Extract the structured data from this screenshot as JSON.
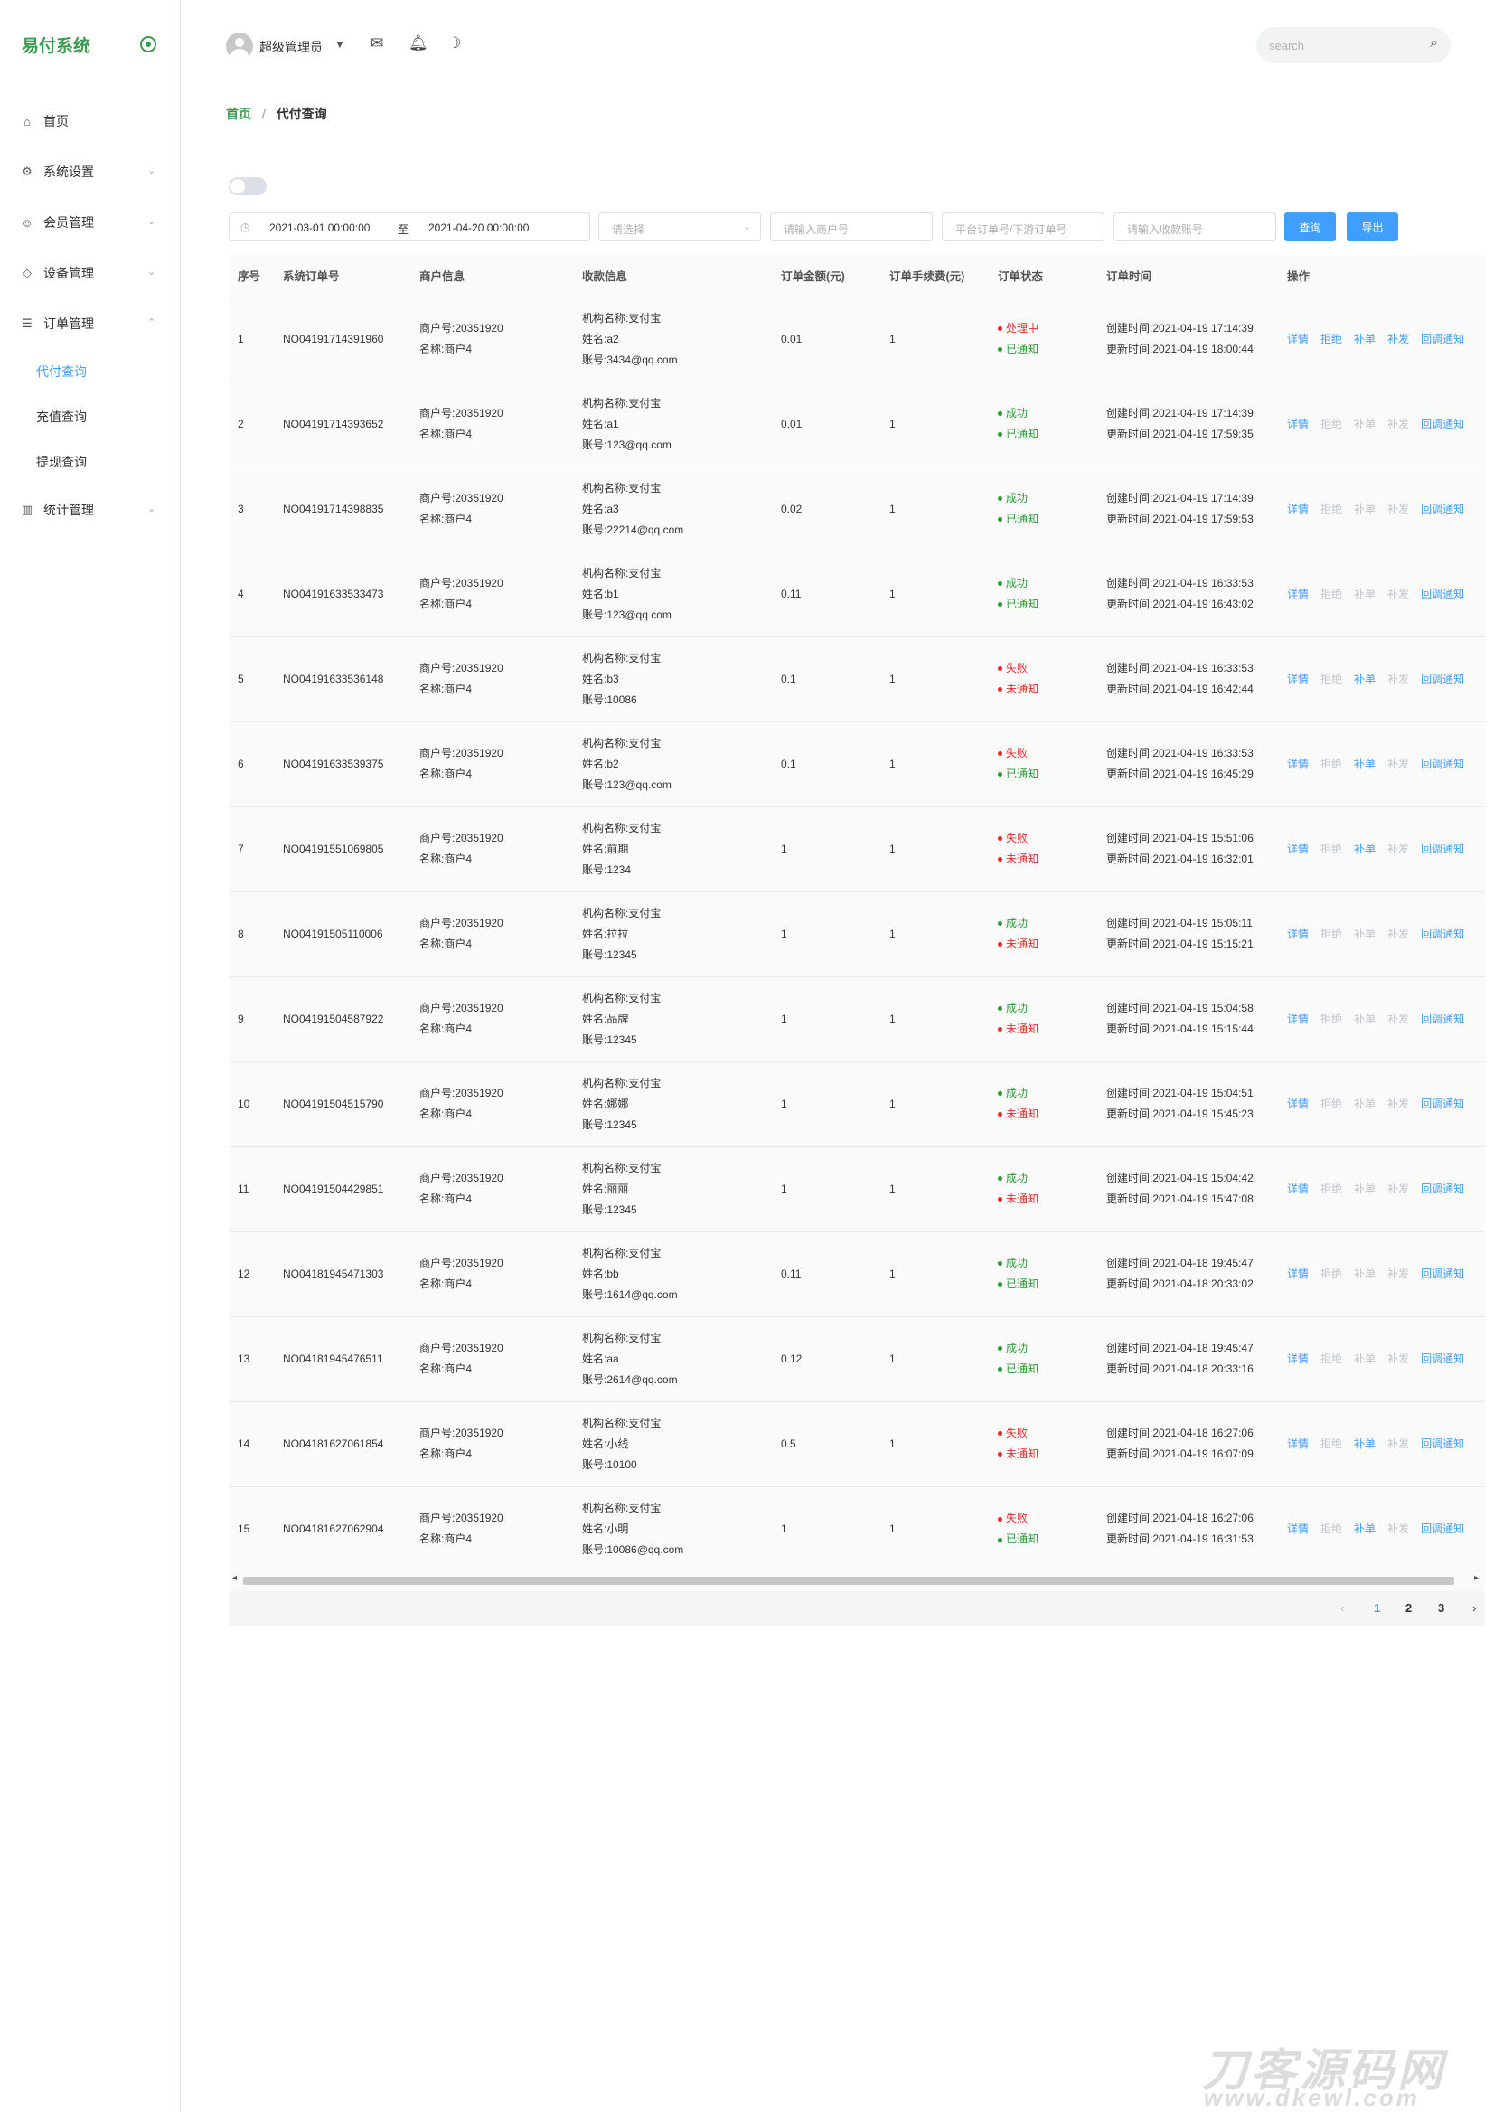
{
  "brand": {
    "name": "易付系统"
  },
  "sidebar": {
    "items": [
      {
        "label": "首页",
        "icon": "home-icon",
        "has_chevron": false
      },
      {
        "label": "系统设置",
        "icon": "gear-icon",
        "has_chevron": true
      },
      {
        "label": "会员管理",
        "icon": "users-icon",
        "has_chevron": true
      },
      {
        "label": "设备管理",
        "icon": "shield-icon",
        "has_chevron": true
      },
      {
        "label": "订单管理",
        "icon": "list-icon",
        "has_chevron": true,
        "expanded": true
      }
    ],
    "submenu": [
      {
        "label": "代付查询",
        "active": true
      },
      {
        "label": "充值查询",
        "active": false
      },
      {
        "label": "提现查询",
        "active": false
      }
    ],
    "last_item": {
      "label": "统计管理",
      "icon": "chart-icon"
    }
  },
  "header": {
    "user_name": "超级管理员",
    "search_placeholder": "search"
  },
  "breadcrumb": {
    "home": "首页",
    "separator": "/",
    "current": "代付查询"
  },
  "filters": {
    "date_start": "2021-03-01 00:00:00",
    "date_sep": "至",
    "date_end": "2021-04-20 00:00:00",
    "select_placeholder": "请选择",
    "merchant_placeholder": "请输入商户号",
    "order_placeholder": "平台订单号/下游订单号",
    "account_placeholder": "请输入收款账号",
    "query_label": "查询",
    "export_label": "导出"
  },
  "table": {
    "headers": [
      "序号",
      "系统订单号",
      "商户信息",
      "收款信息",
      "订单金额(元)",
      "订单手续费(元)",
      "订单状态",
      "订单时间",
      "操作"
    ],
    "op_labels": [
      "详情",
      "拒绝",
      "补单",
      "补发",
      "回调通知"
    ],
    "rows": [
      {
        "no": "1",
        "order": "NO04191714391960",
        "merchant": [
          "商户号:20351920",
          "名称:商户4"
        ],
        "payee": [
          "机构名称:支付宝",
          "姓名:a2",
          "账号:3434@qq.com"
        ],
        "amount": "0.01",
        "fee": "1",
        "status": [
          "处理中",
          "已通知"
        ],
        "status_ok": [
          false,
          true
        ],
        "times": [
          "创建时间:2021-04-19 17:14:39",
          "更新时间:2021-04-19 18:00:44"
        ],
        "ops_on": [
          true,
          true,
          true,
          true,
          true
        ]
      },
      {
        "no": "2",
        "order": "NO04191714393652",
        "merchant": [
          "商户号:20351920",
          "名称:商户4"
        ],
        "payee": [
          "机构名称:支付宝",
          "姓名:a1",
          "账号:123@qq.com"
        ],
        "amount": "0.01",
        "fee": "1",
        "status": [
          "成功",
          "已通知"
        ],
        "status_ok": [
          true,
          true
        ],
        "times": [
          "创建时间:2021-04-19 17:14:39",
          "更新时间:2021-04-19 17:59:35"
        ],
        "ops_on": [
          true,
          false,
          false,
          false,
          true
        ]
      },
      {
        "no": "3",
        "order": "NO04191714398835",
        "merchant": [
          "商户号:20351920",
          "名称:商户4"
        ],
        "payee": [
          "机构名称:支付宝",
          "姓名:a3",
          "账号:22214@qq.com"
        ],
        "amount": "0.02",
        "fee": "1",
        "status": [
          "成功",
          "已通知"
        ],
        "status_ok": [
          true,
          true
        ],
        "times": [
          "创建时间:2021-04-19 17:14:39",
          "更新时间:2021-04-19 17:59:53"
        ],
        "ops_on": [
          true,
          false,
          false,
          false,
          true
        ]
      },
      {
        "no": "4",
        "order": "NO04191633533473",
        "merchant": [
          "商户号:20351920",
          "名称:商户4"
        ],
        "payee": [
          "机构名称:支付宝",
          "姓名:b1",
          "账号:123@qq.com"
        ],
        "amount": "0.11",
        "fee": "1",
        "status": [
          "成功",
          "已通知"
        ],
        "status_ok": [
          true,
          true
        ],
        "times": [
          "创建时间:2021-04-19 16:33:53",
          "更新时间:2021-04-19 16:43:02"
        ],
        "ops_on": [
          true,
          false,
          false,
          false,
          true
        ]
      },
      {
        "no": "5",
        "order": "NO04191633536148",
        "merchant": [
          "商户号:20351920",
          "名称:商户4"
        ],
        "payee": [
          "机构名称:支付宝",
          "姓名:b3",
          "账号:10086"
        ],
        "amount": "0.1",
        "fee": "1",
        "status": [
          "失败",
          "未通知"
        ],
        "status_ok": [
          false,
          false
        ],
        "times": [
          "创建时间:2021-04-19 16:33:53",
          "更新时间:2021-04-19 16:42:44"
        ],
        "ops_on": [
          true,
          false,
          true,
          false,
          true
        ]
      },
      {
        "no": "6",
        "order": "NO04191633539375",
        "merchant": [
          "商户号:20351920",
          "名称:商户4"
        ],
        "payee": [
          "机构名称:支付宝",
          "姓名:b2",
          "账号:123@qq.com"
        ],
        "amount": "0.1",
        "fee": "1",
        "status": [
          "失败",
          "已通知"
        ],
        "status_ok": [
          false,
          true
        ],
        "times": [
          "创建时间:2021-04-19 16:33:53",
          "更新时间:2021-04-19 16:45:29"
        ],
        "ops_on": [
          true,
          false,
          true,
          false,
          true
        ]
      },
      {
        "no": "7",
        "order": "NO04191551069805",
        "merchant": [
          "商户号:20351920",
          "名称:商户4"
        ],
        "payee": [
          "机构名称:支付宝",
          "姓名:前期",
          "账号:1234"
        ],
        "amount": "1",
        "fee": "1",
        "status": [
          "失败",
          "未通知"
        ],
        "status_ok": [
          false,
          false
        ],
        "times": [
          "创建时间:2021-04-19 15:51:06",
          "更新时间:2021-04-19 16:32:01"
        ],
        "ops_on": [
          true,
          false,
          true,
          false,
          true
        ]
      },
      {
        "no": "8",
        "order": "NO04191505110006",
        "merchant": [
          "商户号:20351920",
          "名称:商户4"
        ],
        "payee": [
          "机构名称:支付宝",
          "姓名:拉拉",
          "账号:12345"
        ],
        "amount": "1",
        "fee": "1",
        "status": [
          "成功",
          "未通知"
        ],
        "status_ok": [
          true,
          false
        ],
        "times": [
          "创建时间:2021-04-19 15:05:11",
          "更新时间:2021-04-19 15:15:21"
        ],
        "ops_on": [
          true,
          false,
          false,
          false,
          true
        ]
      },
      {
        "no": "9",
        "order": "NO04191504587922",
        "merchant": [
          "商户号:20351920",
          "名称:商户4"
        ],
        "payee": [
          "机构名称:支付宝",
          "姓名:品牌",
          "账号:12345"
        ],
        "amount": "1",
        "fee": "1",
        "status": [
          "成功",
          "未通知"
        ],
        "status_ok": [
          true,
          false
        ],
        "times": [
          "创建时间:2021-04-19 15:04:58",
          "更新时间:2021-04-19 15:15:44"
        ],
        "ops_on": [
          true,
          false,
          false,
          false,
          true
        ]
      },
      {
        "no": "10",
        "order": "NO04191504515790",
        "merchant": [
          "商户号:20351920",
          "名称:商户4"
        ],
        "payee": [
          "机构名称:支付宝",
          "姓名:娜娜",
          "账号:12345"
        ],
        "amount": "1",
        "fee": "1",
        "status": [
          "成功",
          "未通知"
        ],
        "status_ok": [
          true,
          false
        ],
        "times": [
          "创建时间:2021-04-19 15:04:51",
          "更新时间:2021-04-19 15:45:23"
        ],
        "ops_on": [
          true,
          false,
          false,
          false,
          true
        ]
      },
      {
        "no": "11",
        "order": "NO04191504429851",
        "merchant": [
          "商户号:20351920",
          "名称:商户4"
        ],
        "payee": [
          "机构名称:支付宝",
          "姓名:丽丽",
          "账号:12345"
        ],
        "amount": "1",
        "fee": "1",
        "status": [
          "成功",
          "未通知"
        ],
        "status_ok": [
          true,
          false
        ],
        "times": [
          "创建时间:2021-04-19 15:04:42",
          "更新时间:2021-04-19 15:47:08"
        ],
        "ops_on": [
          true,
          false,
          false,
          false,
          true
        ]
      },
      {
        "no": "12",
        "order": "NO04181945471303",
        "merchant": [
          "商户号:20351920",
          "名称:商户4"
        ],
        "payee": [
          "机构名称:支付宝",
          "姓名:bb",
          "账号:1614@qq.com"
        ],
        "amount": "0.11",
        "fee": "1",
        "status": [
          "成功",
          "已通知"
        ],
        "status_ok": [
          true,
          true
        ],
        "times": [
          "创建时间:2021-04-18 19:45:47",
          "更新时间:2021-04-18 20:33:02"
        ],
        "ops_on": [
          true,
          false,
          false,
          false,
          true
        ]
      },
      {
        "no": "13",
        "order": "NO04181945476511",
        "merchant": [
          "商户号:20351920",
          "名称:商户4"
        ],
        "payee": [
          "机构名称:支付宝",
          "姓名:aa",
          "账号:2614@qq.com"
        ],
        "amount": "0.12",
        "fee": "1",
        "status": [
          "成功",
          "已通知"
        ],
        "status_ok": [
          true,
          true
        ],
        "times": [
          "创建时间:2021-04-18 19:45:47",
          "更新时间:2021-04-18 20:33:16"
        ],
        "ops_on": [
          true,
          false,
          false,
          false,
          true
        ]
      },
      {
        "no": "14",
        "order": "NO04181627061854",
        "merchant": [
          "商户号:20351920",
          "名称:商户4"
        ],
        "payee": [
          "机构名称:支付宝",
          "姓名:小线",
          "账号:10100"
        ],
        "amount": "0.5",
        "fee": "1",
        "status": [
          "失败",
          "未通知"
        ],
        "status_ok": [
          false,
          false
        ],
        "times": [
          "创建时间:2021-04-18 16:27:06",
          "更新时间:2021-04-19 16:07:09"
        ],
        "ops_on": [
          true,
          false,
          true,
          false,
          true
        ]
      },
      {
        "no": "15",
        "order": "NO04181627062904",
        "merchant": [
          "商户号:20351920",
          "名称:商户4"
        ],
        "payee": [
          "机构名称:支付宝",
          "姓名:小明",
          "账号:10086@qq.com"
        ],
        "amount": "1",
        "fee": "1",
        "status": [
          "失败",
          "已通知"
        ],
        "status_ok": [
          false,
          true
        ],
        "times": [
          "创建时间:2021-04-18 16:27:06",
          "更新时间:2021-04-19 16:31:53"
        ],
        "ops_on": [
          true,
          false,
          true,
          false,
          true
        ]
      }
    ]
  },
  "pagination": {
    "pages": [
      "1",
      "2",
      "3"
    ],
    "current": "1"
  },
  "watermark": {
    "main": "刀客源码网",
    "sub": "www.dkewl.com"
  },
  "colors": {
    "brand": "#3a9b4e",
    "accent": "#409eff",
    "success": "#2f9a37",
    "danger": "#e62d2d"
  }
}
